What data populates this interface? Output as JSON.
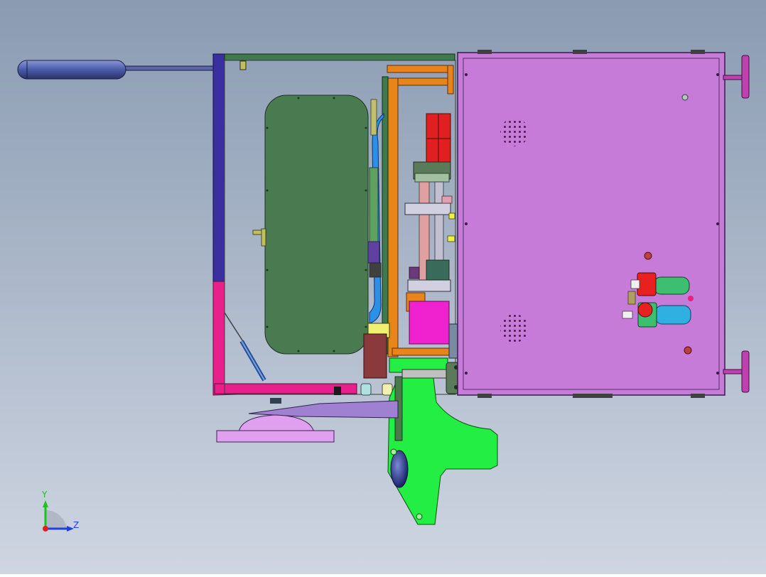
{
  "viewport": {
    "background_top": "#8a9bb2",
    "background_bottom": "#cfd6e2"
  },
  "triad": {
    "y_label": "Y",
    "z_label": "Z",
    "x_color": "#e02020",
    "y_color": "#20c020",
    "z_color": "#2040e0"
  },
  "colors": {
    "cabinet": "#c77bd9",
    "door_frame_blue": "#3a2fa0",
    "door_frame_pink": "#e8208c",
    "panel_green": "#4a7a4f",
    "top_rail": "#3f7a4f",
    "orange_frame": "#e88418",
    "blue_tube": "#2a90e8",
    "red_motor": "#e02020",
    "magenta_block": "#f022d0",
    "green_bracket": "#22ee44",
    "handle": "#4a5aa8",
    "regulator_red": "#e82020",
    "regulator_green": "#3cc070",
    "regulator_cyan": "#30b0e0",
    "foot": "#c040b0",
    "pedal": "#a080d0",
    "pedal_base": "#e0a0f0"
  }
}
